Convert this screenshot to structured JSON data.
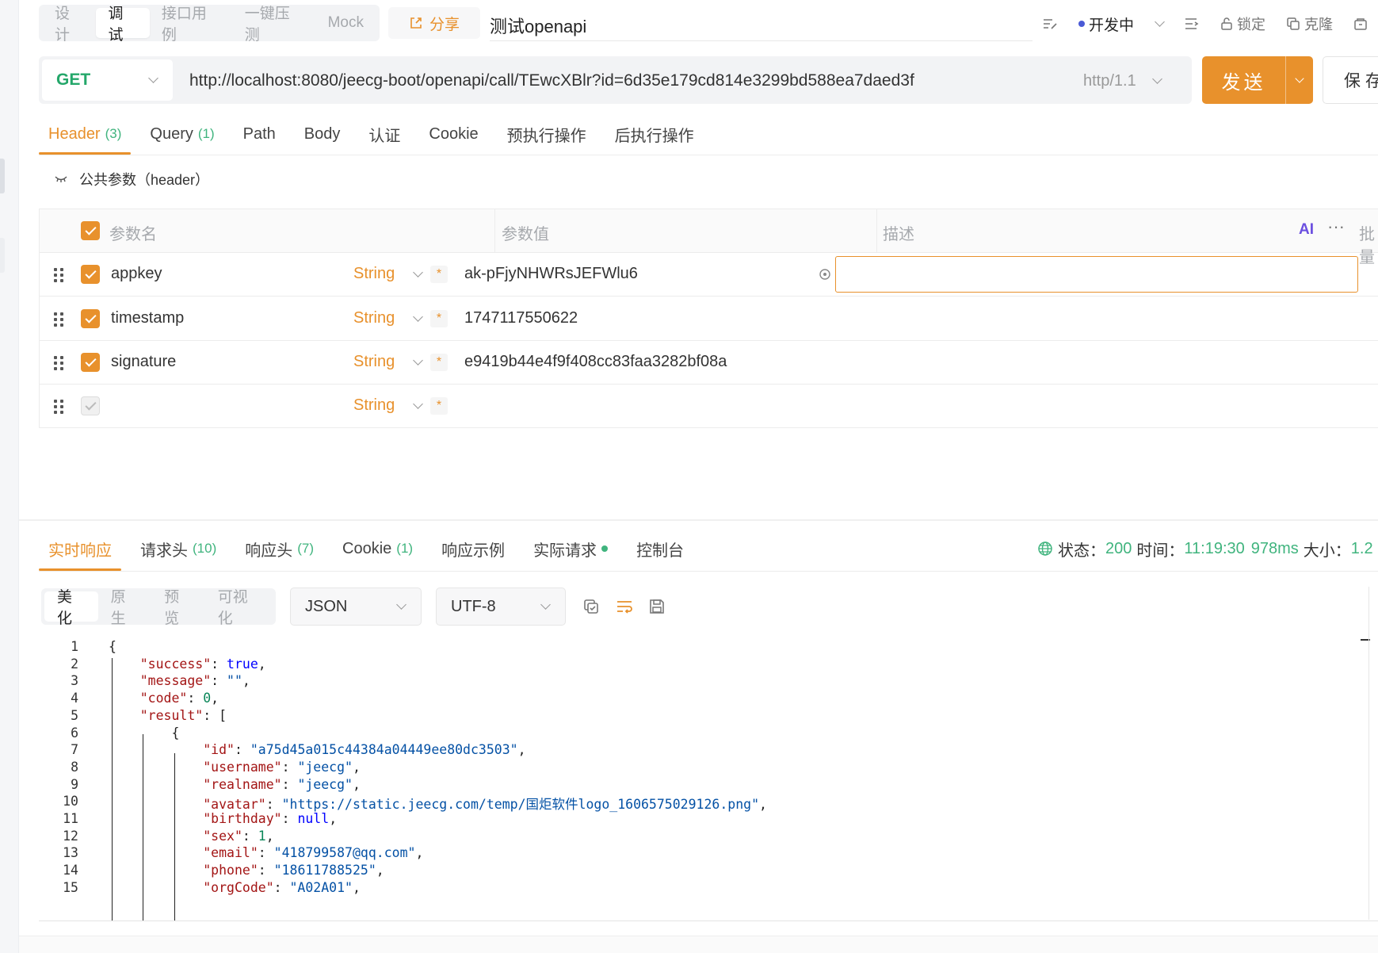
{
  "mode_tabs": [
    {
      "label": "设计"
    },
    {
      "label": "调试"
    },
    {
      "label": "接口用例"
    },
    {
      "label": "一键压测"
    },
    {
      "label": "Mock"
    }
  ],
  "share_label": "分享",
  "api_name": "测试openapi",
  "top_actions": {
    "status": "开发中",
    "lock": "锁定",
    "clone": "克隆"
  },
  "request": {
    "method": "GET",
    "url": "http://localhost:8080/jeecg-boot/openapi/call/TEwcXBlr?id=6d35e179cd814e3299bd588ea7daed3f",
    "http_version": "http/1.1",
    "send_label": "发送",
    "save_label": "保存"
  },
  "req_tabs": [
    {
      "label": "Header",
      "count": "(3)"
    },
    {
      "label": "Query",
      "count": "(1)"
    },
    {
      "label": "Path",
      "count": ""
    },
    {
      "label": "Body",
      "count": ""
    },
    {
      "label": "认证",
      "count": ""
    },
    {
      "label": "Cookie",
      "count": ""
    },
    {
      "label": "预执行操作",
      "count": ""
    },
    {
      "label": "后执行操作",
      "count": ""
    }
  ],
  "public_params_label": "公共参数（header）",
  "param_table": {
    "headers": {
      "name": "参数名",
      "value": "参数值",
      "desc": "描述",
      "bulk": "批量"
    },
    "rows": [
      {
        "name": "appkey",
        "type": "String",
        "value": "ak-pFjyNHWRsJEFWlu6",
        "checked": true
      },
      {
        "name": "timestamp",
        "type": "String",
        "value": "1747117550622",
        "checked": true
      },
      {
        "name": "signature",
        "type": "String",
        "value": "e9419b44e4f9f408cc83faa3282bf08a",
        "checked": true
      },
      {
        "name": "",
        "type": "String",
        "value": "",
        "checked": false
      }
    ]
  },
  "resp_tabs": [
    {
      "label": "实时响应",
      "count": ""
    },
    {
      "label": "请求头",
      "count": "(10)"
    },
    {
      "label": "响应头",
      "count": "(7)"
    },
    {
      "label": "Cookie",
      "count": "(1)"
    },
    {
      "label": "响应示例",
      "count": ""
    },
    {
      "label": "实际请求",
      "count": ""
    },
    {
      "label": "控制台",
      "count": ""
    }
  ],
  "resp_status": {
    "status_label": "状态：",
    "status_value": "200",
    "time_label": "时间：",
    "time_value": "11:19:30",
    "duration": "978ms",
    "size_label": "大小：",
    "size_value": "1.2"
  },
  "view_tabs": [
    {
      "label": "美化"
    },
    {
      "label": "原生"
    },
    {
      "label": "预览"
    },
    {
      "label": "可视化"
    }
  ],
  "format_select": "JSON",
  "encoding_select": "UTF-8",
  "code_lines": [
    "{",
    "    \"success\": true,",
    "    \"message\": \"\",",
    "    \"code\": 0,",
    "    \"result\": [",
    "        {",
    "            \"id\": \"a75d45a015c44384a04449ee80dc3503\",",
    "            \"username\": \"jeecg\",",
    "            \"realname\": \"jeecg\",",
    "            \"avatar\": \"https://static.jeecg.com/temp/国炬软件logo_1606575029126.png\",",
    "            \"birthday\": null,",
    "            \"sex\": 1,",
    "            \"email\": \"418799587@qq.com\",",
    "            \"phone\": \"18611788525\",",
    "            \"orgCode\": \"A02A01\","
  ],
  "colors": {
    "accent": "#e8912c",
    "method_get": "#24a76a",
    "count_green": "#40b47e",
    "status_blue": "#4a5ad6"
  }
}
